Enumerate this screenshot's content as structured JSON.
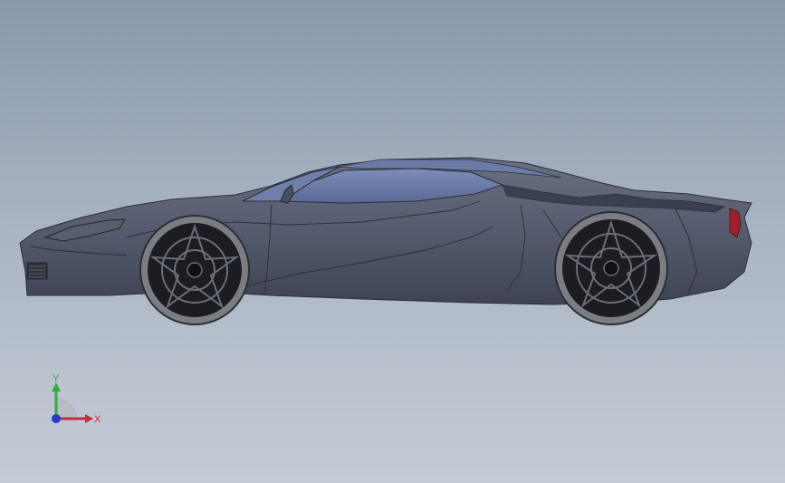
{
  "viewport": {
    "background_top": "#8a98ab",
    "background_bottom": "#c6ccd6"
  },
  "model": {
    "body_color": "#555b6e",
    "glass_color": "#6f7eaa",
    "tire_color": "#7a7d82",
    "rim_color": "#1c1d22",
    "taillight_color": "#a0202a"
  },
  "triad": {
    "y_label": "Y",
    "x_label": "X",
    "y_color": "#2fae3a",
    "x_color": "#c0303a",
    "z_color": "#2a3ac8"
  }
}
